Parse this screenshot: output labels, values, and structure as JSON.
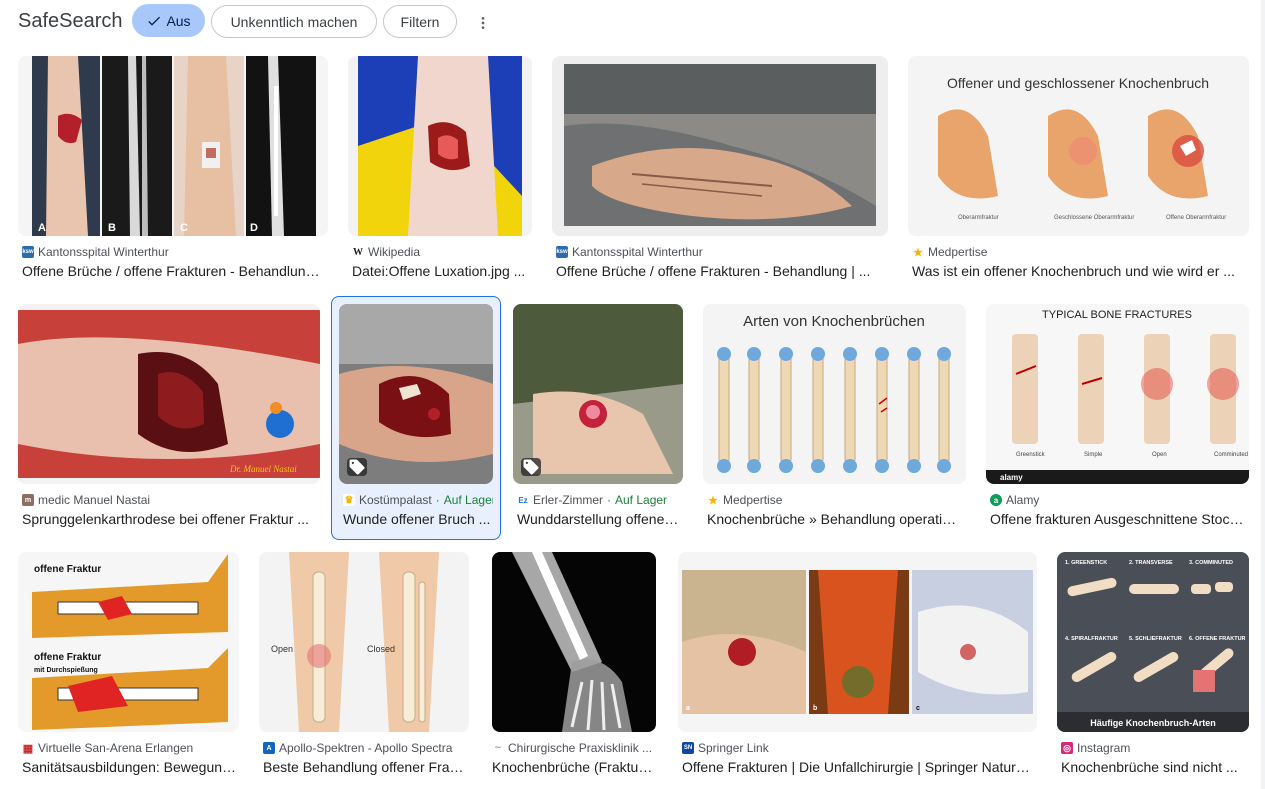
{
  "header": {
    "title": "SafeSearch",
    "aus_label": "Aus",
    "unkenntlich_label": "Unkenntlich machen",
    "filter_label": "Filtern",
    "more_icon": "more-vert-icon"
  },
  "results": [
    {
      "source": "Kantonsspital Winterthur",
      "title": "Offene Brüche / offene Frakturen - Behandlung ...",
      "favicon_color": "#2b6cb0",
      "favicon_text": "ksw"
    },
    {
      "source": "Wikipedia",
      "title": "Datei:Offene Luxation.jpg ...",
      "favicon_color": "#202124",
      "favicon_text": "W"
    },
    {
      "source": "Kantonsspital Winterthur",
      "title": "Offene Brüche / offene Frakturen - Behandlung | ...",
      "favicon_color": "#2b6cb0",
      "favicon_text": "ksw"
    },
    {
      "source": "Medpertise",
      "title": "Was ist ein offener Knochenbruch und wie wird er ...",
      "favicon_color": "#f4b400",
      "favicon_text": "★"
    },
    {
      "source": "medic Manuel Nastai",
      "title": "Sprunggelenkarthrodese bei offener Fraktur ...",
      "favicon_color": "#8d6e63",
      "favicon_text": "m"
    },
    {
      "source": "Kostümpalast",
      "stock": "Auf Lager",
      "title": "Wunde offener Bruch ...",
      "favicon_color": "#f4b400",
      "favicon_text": "♛"
    },
    {
      "source": "Erler-Zimmer",
      "stock": "Auf Lager",
      "title": "Wunddarstellung offener ...",
      "favicon_color": "#1a73e8",
      "favicon_text": "Ez"
    },
    {
      "source": "Medpertise",
      "title": "Knochenbrüche » Behandlung operativ ...",
      "favicon_color": "#f4b400",
      "favicon_text": "★"
    },
    {
      "source": "Alamy",
      "title": "Offene frakturen Ausgeschnittene Stock ...",
      "favicon_color": "#0f9d58",
      "favicon_text": "a"
    },
    {
      "source": "Virtuelle San-Arena Erlangen",
      "title": "Sanitätsausbildungen: Bewegungs...",
      "favicon_color": "#c62828",
      "favicon_text": "▦"
    },
    {
      "source": "Apollo-Spektren - Apollo Spectra",
      "title": "Beste Behandlung offener Fraktur ...",
      "favicon_color": "#1565c0",
      "favicon_text": "A"
    },
    {
      "source": "Chirurgische Praxisklinik ...",
      "title": "Knochenbrüche (Frakturen) ...",
      "favicon_color": "#90a4ae",
      "favicon_text": "~"
    },
    {
      "source": "Springer Link",
      "title": "Offene Frakturen | Die Unfallchirurgie | Springer Nature ...",
      "favicon_color": "#0d47a1",
      "favicon_text": "SN"
    },
    {
      "source": "Instagram",
      "title": "Knochenbrüche sind nicht ...",
      "favicon_color": "#d62976",
      "favicon_text": "◎"
    }
  ],
  "image_text": {
    "r1c1_labels": [
      "A",
      "B",
      "C",
      "D"
    ],
    "r1c4_heading": "Offener und geschlossener Knochenbruch",
    "r1c4_labels": [
      "Oberarmfraktur",
      "Geschlossene Oberarmfraktur",
      "Offene Oberarmfraktur"
    ],
    "r2c1_watermark": "Dr. Manuel Nastai",
    "r2c4_heading": "Arten von Knochenbrüchen",
    "r2c5_heading": "TYPICAL BONE FRACTURES",
    "r2c5_labels": [
      "Greenstick",
      "Simple",
      "Open",
      "Comminuted"
    ],
    "r2c5_brand": "alamy",
    "r3c1_labels": [
      "offene Fraktur",
      "offene Fraktur",
      "mit Durchspießung"
    ],
    "r3c2_labels": [
      "Open",
      "Closed"
    ],
    "r3c4_labels": [
      "a",
      "b",
      "c"
    ],
    "r3c5_labels": [
      "1. GREENSTICK",
      "2. TRANSVERSE",
      "3. COMMINUTED",
      "4. SPIRALFRAKTUR",
      "5. SCHLIEFRAKTUR",
      "6. OFFENE FRAKTUR"
    ],
    "r3c5_footer": "Häufige Knochenbruch-Arten"
  },
  "colors": {
    "aus_chip": "#a8c7fa",
    "selected_border": "#1a73e8",
    "stock_green": "#188038"
  }
}
